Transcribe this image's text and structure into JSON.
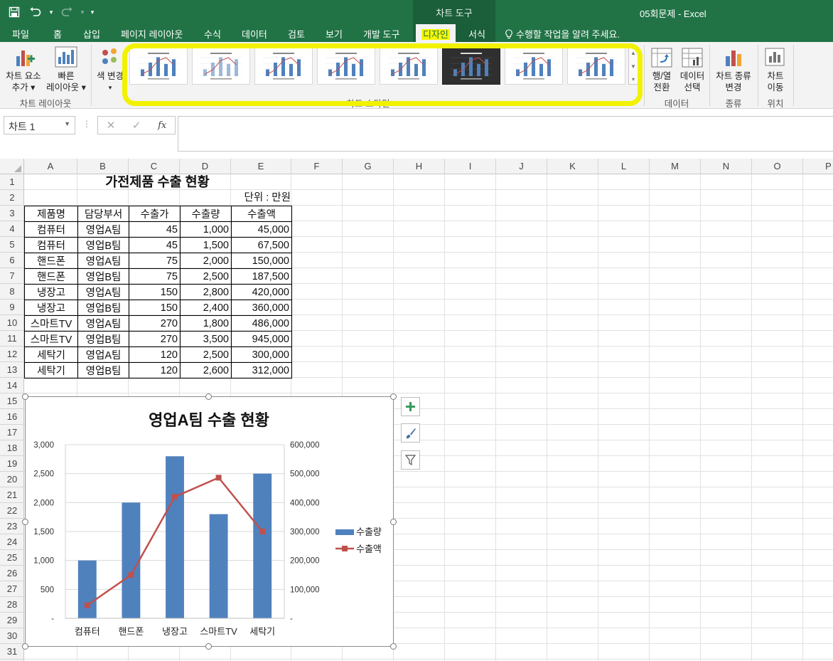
{
  "titlebar": {
    "context_group": "차트 도구",
    "app_title": "05회문제 - Excel"
  },
  "ribbon_tabs": [
    "파일",
    "홈",
    "삽입",
    "페이지 레이아웃",
    "수식",
    "데이터",
    "검토",
    "보기",
    "개발 도구",
    "디자인",
    "서식"
  ],
  "active_tab": "디자인",
  "tell_me": "수행할 작업을 알려 주세요.",
  "ribbon": {
    "add_element": [
      "차트 요소",
      "추가"
    ],
    "quick_layout": [
      "빠른",
      "레이아웃"
    ],
    "group_layout": "차트 레이아웃",
    "change_color": "색 변경",
    "group_styles": "차트 스타일",
    "switch_row_col": [
      "행/열",
      "전환"
    ],
    "select_data": [
      "데이터",
      "선택"
    ],
    "group_data": "데이터",
    "change_type": [
      "차트 종류",
      "변경"
    ],
    "group_type": "종류",
    "move_chart": [
      "차트",
      "이동"
    ],
    "group_location": "위치",
    "chart_style_count": 8,
    "selected_style_index": 5
  },
  "formula_bar": {
    "name_box": "차트 1",
    "fx": "fx"
  },
  "columns": [
    "A",
    "B",
    "C",
    "D",
    "E",
    "F",
    "G",
    "H",
    "I",
    "J",
    "K",
    "L",
    "M",
    "N",
    "O",
    "P"
  ],
  "rows": [
    "1",
    "2",
    "3",
    "4",
    "5",
    "6",
    "7",
    "8",
    "9",
    "10",
    "11",
    "12",
    "13",
    "14",
    "15",
    "16",
    "17",
    "18",
    "19",
    "20",
    "21",
    "22",
    "23",
    "24",
    "25",
    "26",
    "27",
    "28",
    "29",
    "30",
    "31"
  ],
  "sheet": {
    "title": "가전제품 수출 현황",
    "unit": "단위 : 만원",
    "headers": [
      "제품명",
      "담당부서",
      "수출가",
      "수출량",
      "수출액"
    ],
    "rows": [
      [
        "컴퓨터",
        "영업A팀",
        "45",
        "1,000",
        "45,000"
      ],
      [
        "컴퓨터",
        "영업B팀",
        "45",
        "1,500",
        "67,500"
      ],
      [
        "핸드폰",
        "영업A팀",
        "75",
        "2,000",
        "150,000"
      ],
      [
        "핸드폰",
        "영업B팀",
        "75",
        "2,500",
        "187,500"
      ],
      [
        "냉장고",
        "영업A팀",
        "150",
        "2,800",
        "420,000"
      ],
      [
        "냉장고",
        "영업B팀",
        "150",
        "2,400",
        "360,000"
      ],
      [
        "스마트TV",
        "영업A팀",
        "270",
        "1,800",
        "486,000"
      ],
      [
        "스마트TV",
        "영업B팀",
        "270",
        "3,500",
        "945,000"
      ],
      [
        "세탁기",
        "영업A팀",
        "120",
        "2,500",
        "300,000"
      ],
      [
        "세탁기",
        "영업B팀",
        "120",
        "2,600",
        "312,000"
      ]
    ]
  },
  "chart_data": {
    "type": "bar",
    "title": "영업A팀 수출 현황",
    "categories": [
      "컴퓨터",
      "핸드폰",
      "냉장고",
      "스마트TV",
      "세탁기"
    ],
    "series": [
      {
        "name": "수출량",
        "type": "bar",
        "axis": "primary",
        "color": "#4f81bd",
        "values": [
          1000,
          2000,
          2800,
          1800,
          2500
        ]
      },
      {
        "name": "수출액",
        "type": "line",
        "axis": "secondary",
        "color": "#c0504d",
        "values": [
          45000,
          150000,
          420000,
          486000,
          300000
        ]
      }
    ],
    "ylim": [
      0,
      3000
    ],
    "y2lim": [
      0,
      600000
    ],
    "y_ticks": [
      "-",
      "500",
      "1,000",
      "1,500",
      "2,000",
      "2,500",
      "3,000"
    ],
    "y2_ticks": [
      "-",
      "100,000",
      "200,000",
      "300,000",
      "400,000",
      "500,000",
      "600,000"
    ],
    "legend": "right",
    "grid": true
  }
}
